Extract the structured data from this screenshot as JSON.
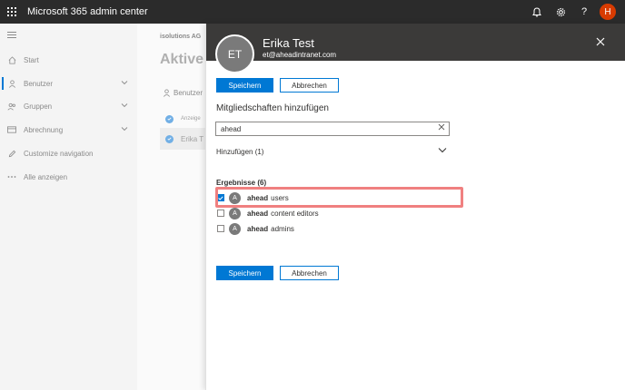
{
  "topbar": {
    "title": "Microsoft 365 admin center",
    "avatar_initial": "H",
    "help_label": "?"
  },
  "leftnav": {
    "items": [
      {
        "label": "Start",
        "icon": "home-icon"
      },
      {
        "label": "Benutzer",
        "icon": "person-icon"
      },
      {
        "label": "Gruppen",
        "icon": "group-icon"
      },
      {
        "label": "Abrechnung",
        "icon": "card-icon"
      },
      {
        "label": "Customize navigation",
        "icon": "pencil-icon"
      },
      {
        "label": "Alle anzeigen",
        "icon": "more-icon"
      }
    ]
  },
  "main": {
    "org_name": "isolutions AG",
    "page_title": "Aktive",
    "cmd_user": "Benutzer",
    "table_header": "Anzeige",
    "row_name": "Erika T"
  },
  "panel": {
    "avatar_initials": "ET",
    "name": "Erika Test",
    "email": "et@aheadintranet.com",
    "save_label": "Speichern",
    "cancel_label": "Abbrechen",
    "section_title": "Mitgliedschaften hinzufügen",
    "search_value": "ahead",
    "added_label": "Hinzufügen (1)",
    "results_label": "Ergebnisse (6)",
    "results": [
      {
        "initial": "A",
        "bold": "ahead",
        "rest": "users",
        "checked": true
      },
      {
        "initial": "A",
        "bold": "ahead",
        "rest": "content editors",
        "checked": false
      },
      {
        "initial": "A",
        "bold": "ahead",
        "rest": "admins",
        "checked": false
      }
    ]
  },
  "colors": {
    "accent": "#0078d4",
    "topbar": "#2b2b2b",
    "highlight": "#f08080"
  }
}
